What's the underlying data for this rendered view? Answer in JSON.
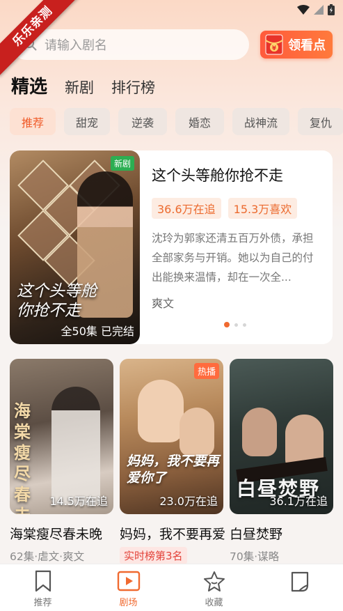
{
  "watermark": "乐乐亲测",
  "search": {
    "placeholder": "请输入剧名"
  },
  "redpack": {
    "label": "领看点"
  },
  "tabs": [
    {
      "label": "精选",
      "active": true
    },
    {
      "label": "新剧",
      "active": false
    },
    {
      "label": "排行榜",
      "active": false
    }
  ],
  "chips": [
    {
      "label": "推荐",
      "active": true
    },
    {
      "label": "甜宠",
      "active": false
    },
    {
      "label": "逆袭",
      "active": false
    },
    {
      "label": "婚恋",
      "active": false
    },
    {
      "label": "战神流",
      "active": false
    },
    {
      "label": "复仇",
      "active": false
    }
  ],
  "featured": {
    "tag": "新剧",
    "poster_title": "这个头等舱你抢不走",
    "episodes": "全50集  已完结",
    "title": "这个头等舱你抢不走",
    "followers": "36.6万在追",
    "likes": "15.3万喜欢",
    "description": "沈玲为郭家还清五百万外债，承担全部家务与开销。她以为自己的付出能换来温情，却在一次全...",
    "genre": "爽文",
    "carousel_total": 3,
    "carousel_active": 0
  },
  "cards": [
    {
      "title": "海棠瘦尽春未晚",
      "poster_title": "海棠瘦尽春未晚",
      "followers": "14.5万在追",
      "sub": "62集·虐文·爽文",
      "hot": "",
      "rank": ""
    },
    {
      "title": "妈妈，我不要再爱你了",
      "poster_title": "妈妈，我不要再爱你了",
      "followers": "23.0万在追",
      "sub": "",
      "hot": "热播",
      "rank": "实时榜第3名"
    },
    {
      "title": "白昼焚野",
      "poster_title": "白昼焚野",
      "followers": "36.1万在追",
      "sub": "70集·谋略",
      "hot": "",
      "rank": ""
    }
  ],
  "bottom_nav": [
    {
      "label": "推荐",
      "icon": "bookmark-icon",
      "active": false
    },
    {
      "label": "剧场",
      "icon": "play-icon",
      "active": true
    },
    {
      "label": "收藏",
      "icon": "star-icon",
      "active": false
    },
    {
      "label": "",
      "icon": "profile-icon",
      "active": false
    }
  ],
  "colors": {
    "accent": "#f06a30",
    "rank": "#e3433a",
    "new_tag": "#2cae52"
  }
}
